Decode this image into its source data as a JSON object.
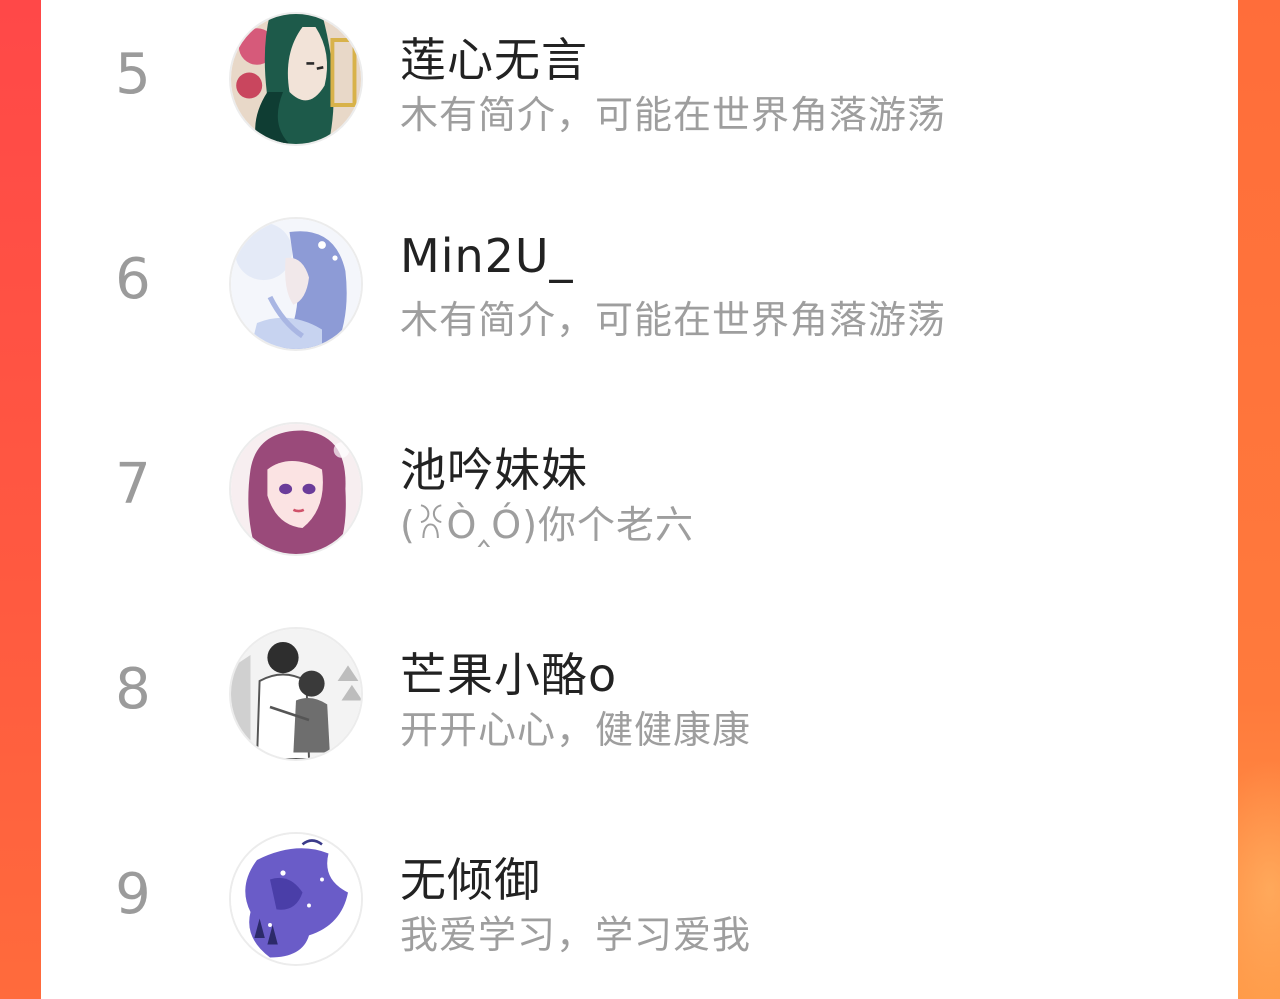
{
  "ranking": {
    "items": [
      {
        "rank": "5",
        "name": "莲心无言",
        "bio": "木有简介，可能在世界角落游荡",
        "avatar_icon": "avatar-green-hair-girl"
      },
      {
        "rank": "6",
        "name": "Min2U_",
        "bio": "木有简介，可能在世界角落游荡",
        "avatar_icon": "avatar-blue-hair-boy"
      },
      {
        "rank": "7",
        "name": "池吟妹妹",
        "bio": "(ꐦÒ‸Ó)你个老六",
        "avatar_icon": "avatar-pink-hair-girl"
      },
      {
        "rank": "8",
        "name": "芒果小酪o",
        "bio": "开开心心，健健康康",
        "avatar_icon": "avatar-manga-couple"
      },
      {
        "rank": "9",
        "name": "无倾御",
        "bio": "我爱学习，学习爱我",
        "avatar_icon": "avatar-purple-night-scene"
      }
    ]
  },
  "colors": {
    "background_accent": "#ff5a40",
    "rank_text": "#9b9b9b",
    "name_text": "#222222",
    "bio_text": "#9e9e9e"
  }
}
